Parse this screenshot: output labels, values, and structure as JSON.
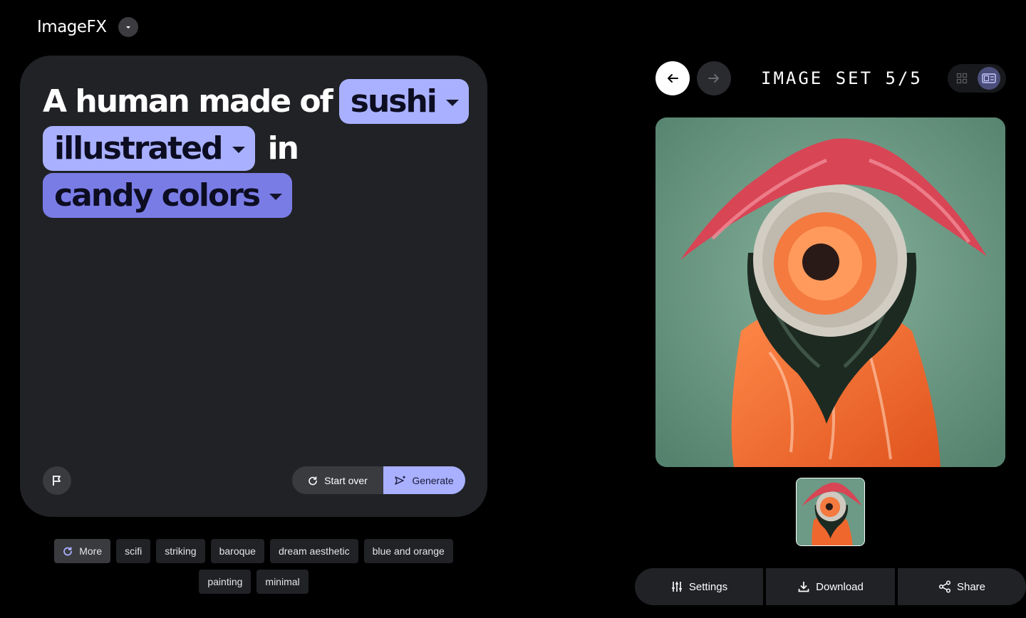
{
  "app": {
    "title": "ImageFX"
  },
  "prompt": {
    "prefix": "A human made of",
    "chip_subject": "sushi",
    "chip_style": "illustrated",
    "connector": "in",
    "chip_color": "candy colors"
  },
  "actions": {
    "start_over": "Start over",
    "generate": "Generate"
  },
  "suggestions": {
    "more": "More",
    "items": [
      "scifi",
      "striking",
      "baroque",
      "dream aesthetic",
      "blue and orange",
      "painting",
      "minimal"
    ]
  },
  "viewer": {
    "set_label": "IMAGE SET 5/5",
    "settings": "Settings",
    "download": "Download",
    "share": "Share"
  },
  "colors": {
    "background": "#000000",
    "card": "#212226",
    "chip_light": "#a9b0ff",
    "chip_dark": "#7a7ce6"
  },
  "icons": [
    "chevron-down-icon",
    "flag-icon",
    "refresh-icon",
    "send-sparkle-icon",
    "arrow-left-icon",
    "arrow-right-icon",
    "grid-icon",
    "single-view-icon",
    "sliders-icon",
    "download-icon",
    "share-icon"
  ]
}
